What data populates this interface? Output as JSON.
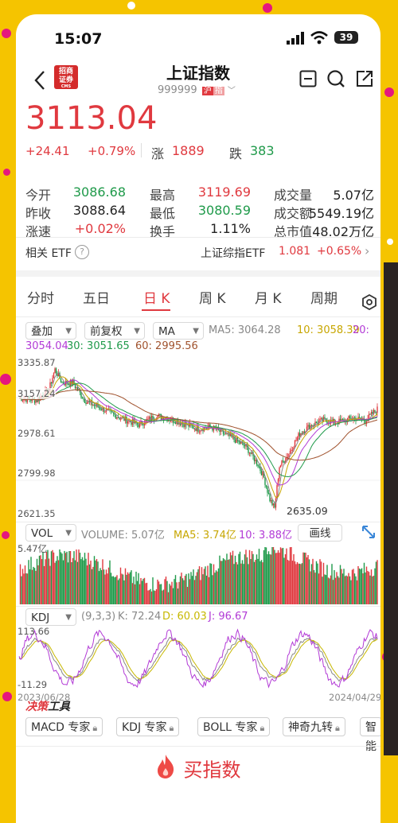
{
  "status": {
    "time": "15:07",
    "battery": "39"
  },
  "header": {
    "title": "上证指数",
    "code": "999999",
    "market_tag": "沪",
    "tag2": "指",
    "brand_top": "招商",
    "brand_bottom": "证券",
    "brand_sub": "CMS"
  },
  "price": {
    "last": "3113.04",
    "change": "+24.41",
    "change_pct": "+0.79%",
    "up_label": "涨",
    "up_count": "1889",
    "down_label": "跌",
    "down_count": "383"
  },
  "stats": [
    {
      "label": "今开",
      "value": "3086.68",
      "color": "green"
    },
    {
      "label": "最高",
      "value": "3119.69",
      "color": "red"
    },
    {
      "label": "成交量",
      "value": "5.07亿",
      "color": "black"
    },
    {
      "label": "昨收",
      "value": "3088.64",
      "color": "black"
    },
    {
      "label": "最低",
      "value": "3080.59",
      "color": "green"
    },
    {
      "label": "成交额",
      "value": "5549.19亿",
      "color": "black"
    },
    {
      "label": "涨速",
      "value": "+0.02%",
      "color": "red"
    },
    {
      "label": "换手",
      "value": "1.11%",
      "color": "black"
    },
    {
      "label": "总市值",
      "value": "48.02万亿",
      "color": "black"
    }
  ],
  "etf": {
    "label": "相关 ETF",
    "name": "上证综指ETF",
    "price": "1.081",
    "change": "+0.65%"
  },
  "tabs": [
    "分时",
    "五日",
    "日 K",
    "周 K",
    "月 K",
    "周期"
  ],
  "selected_tab": "日 K",
  "controls": {
    "adjust": "叠加",
    "fq": "前复权",
    "ma": "MA"
  },
  "ma_legend": {
    "ma5": "MA5: 3064.28",
    "ma10": "10: 3058.39",
    "ma20_a": "20:",
    "ma20_b": "3054.04",
    "ma30": "30: 3051.65",
    "ma60": "60: 2995.56"
  },
  "price_axis": [
    "3335.87",
    "3157.24",
    "2978.61",
    "2799.98",
    "2621.35"
  ],
  "min_label": "2635.09",
  "vol": {
    "select": "VOL",
    "volume": "VOLUME: 5.07亿",
    "ma5": "MA5: 3.74亿",
    "ma10": "10: 3.88亿",
    "draw_btn": "画线",
    "axis_top": "5.47亿"
  },
  "kdj": {
    "select": "KDJ",
    "params": "(9,3,3)",
    "k": "K: 72.24",
    "d": "D: 60.03",
    "j": "J: 96.67",
    "axis_top": "113.66",
    "axis_bottom": "-11.29"
  },
  "dates": {
    "start": "2023/06/28",
    "end": "2024/04/29"
  },
  "decision": {
    "title_a": "决策",
    "title_b": "工具"
  },
  "tools": [
    "MACD 专家",
    "KDJ 专家",
    "BOLL 专家",
    "神奇九转",
    "智能"
  ],
  "buy_button": "买指数",
  "colors": {
    "up": "#e0393f",
    "down": "#1f9a4a",
    "ma5": "#888888",
    "ma10": "#c7a600",
    "ma20": "#b23ad6",
    "ma30": "#1f9a4a",
    "ma60": "#a0522d",
    "k": "#888888",
    "d": "#c7b800",
    "j": "#b23ad6"
  }
}
